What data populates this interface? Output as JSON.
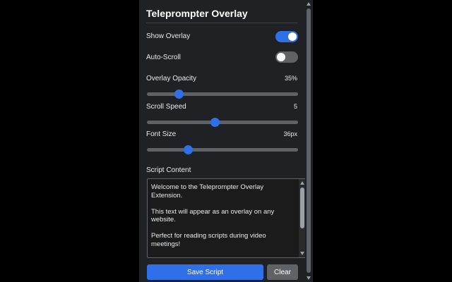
{
  "header": {
    "title": "Teleprompter Overlay"
  },
  "settings": {
    "show_overlay": {
      "label": "Show Overlay",
      "on": true
    },
    "auto_scroll": {
      "label": "Auto-Scroll",
      "on": false
    },
    "opacity": {
      "label": "Overlay Opacity",
      "value_text": "35%",
      "fraction": 0.21
    },
    "scroll_speed": {
      "label": "Scroll Speed",
      "value_text": "5",
      "fraction": 0.45
    },
    "font_size": {
      "label": "Font Size",
      "value_text": "36px",
      "fraction": 0.27
    }
  },
  "script": {
    "label": "Script Content",
    "content": "Welcome to the Teleprompter Overlay Extension.\n\nThis text will appear as an overlay on any website.\n\nPerfect for reading scripts during video meetings!\n\nUse keyboard shortcuts for quick control:\n- Space: Play/Pause\n- Arrow Up/Down: Speed control\n- Escape: Hide overlay"
  },
  "buttons": {
    "save": "Save Script",
    "clear": "Clear"
  },
  "colors": {
    "accent": "#2f6fe8",
    "track": "#5f6368",
    "panel_bg": "#202124"
  }
}
